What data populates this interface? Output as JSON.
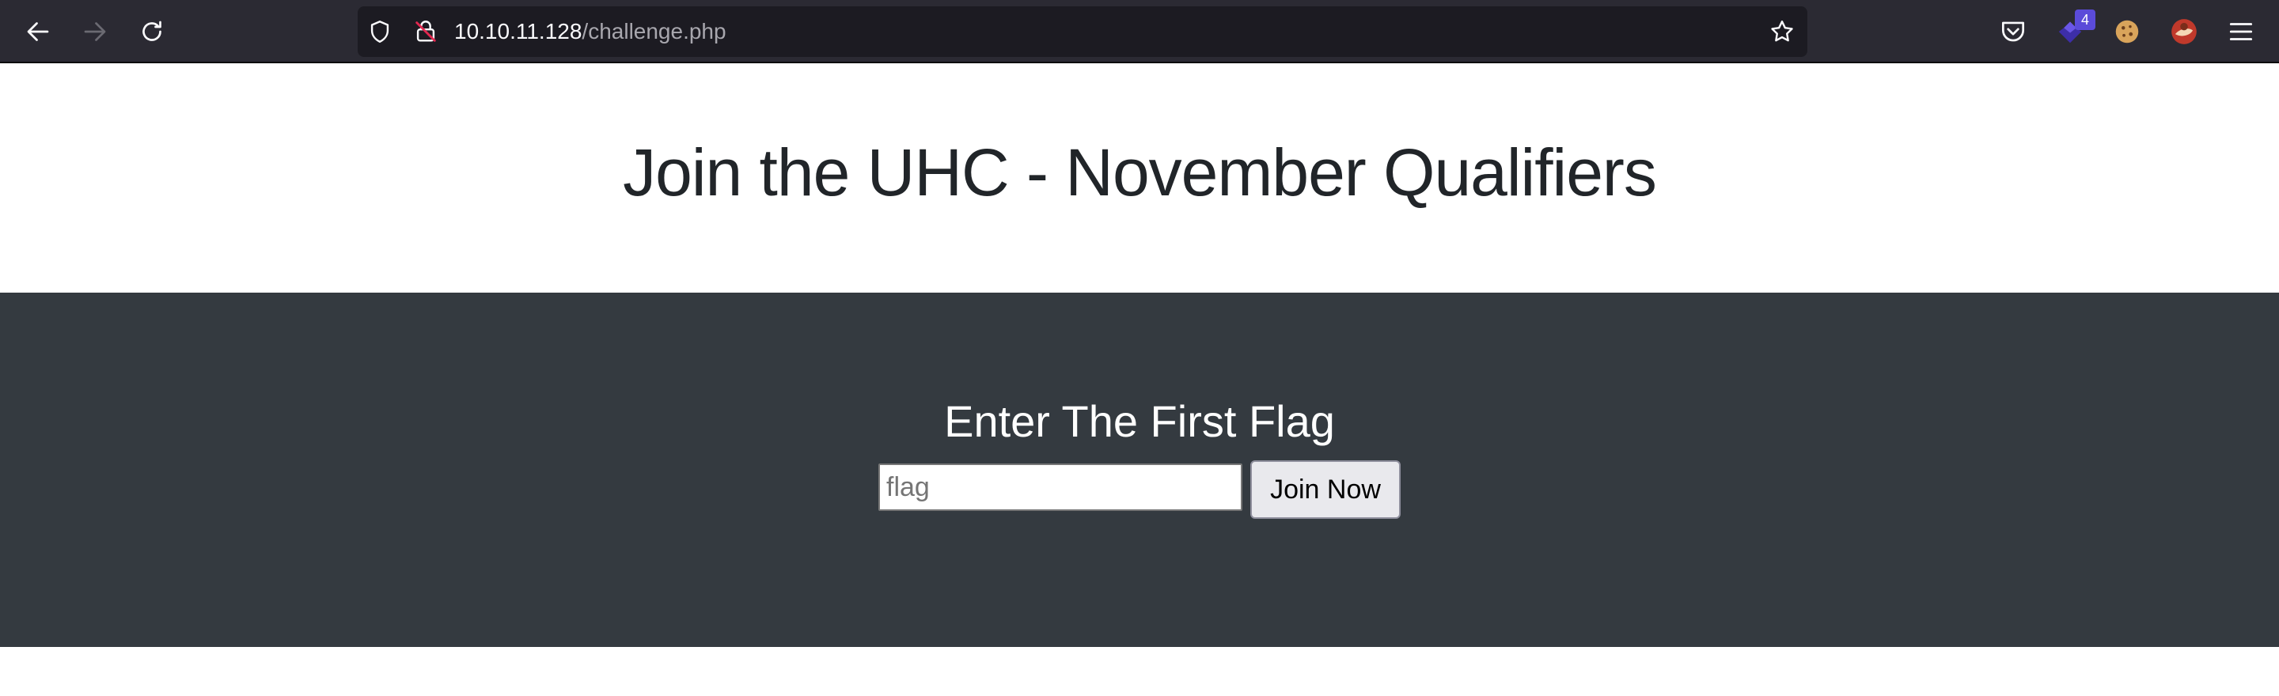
{
  "browser": {
    "url_host": "10.10.11.128",
    "url_path": "/challenge.php",
    "icons": {
      "back": "arrow-left-icon",
      "forward": "arrow-right-icon",
      "reload": "reload-icon",
      "tracking_protection": "shield-icon",
      "connection": "insecure-lock-icon",
      "bookmark": "star-icon",
      "pocket": "pocket-icon",
      "extension": "extension-icon",
      "cookie": "cookie-icon",
      "profile": "avatar-icon",
      "menu": "hamburger-menu-icon"
    },
    "extension_badge": "4"
  },
  "page": {
    "title": "Join the UHC - November Qualifiers",
    "section_title": "Enter The First Flag",
    "flag_input": {
      "value": "",
      "placeholder": "flag"
    },
    "join_button_label": "Join Now"
  },
  "colors": {
    "toolbar_bg": "#2b2a33",
    "urlbar_bg": "#1c1b22",
    "dark_section_bg": "#343a40",
    "title_text": "#212529",
    "badge_bg": "#5b4bd9"
  }
}
